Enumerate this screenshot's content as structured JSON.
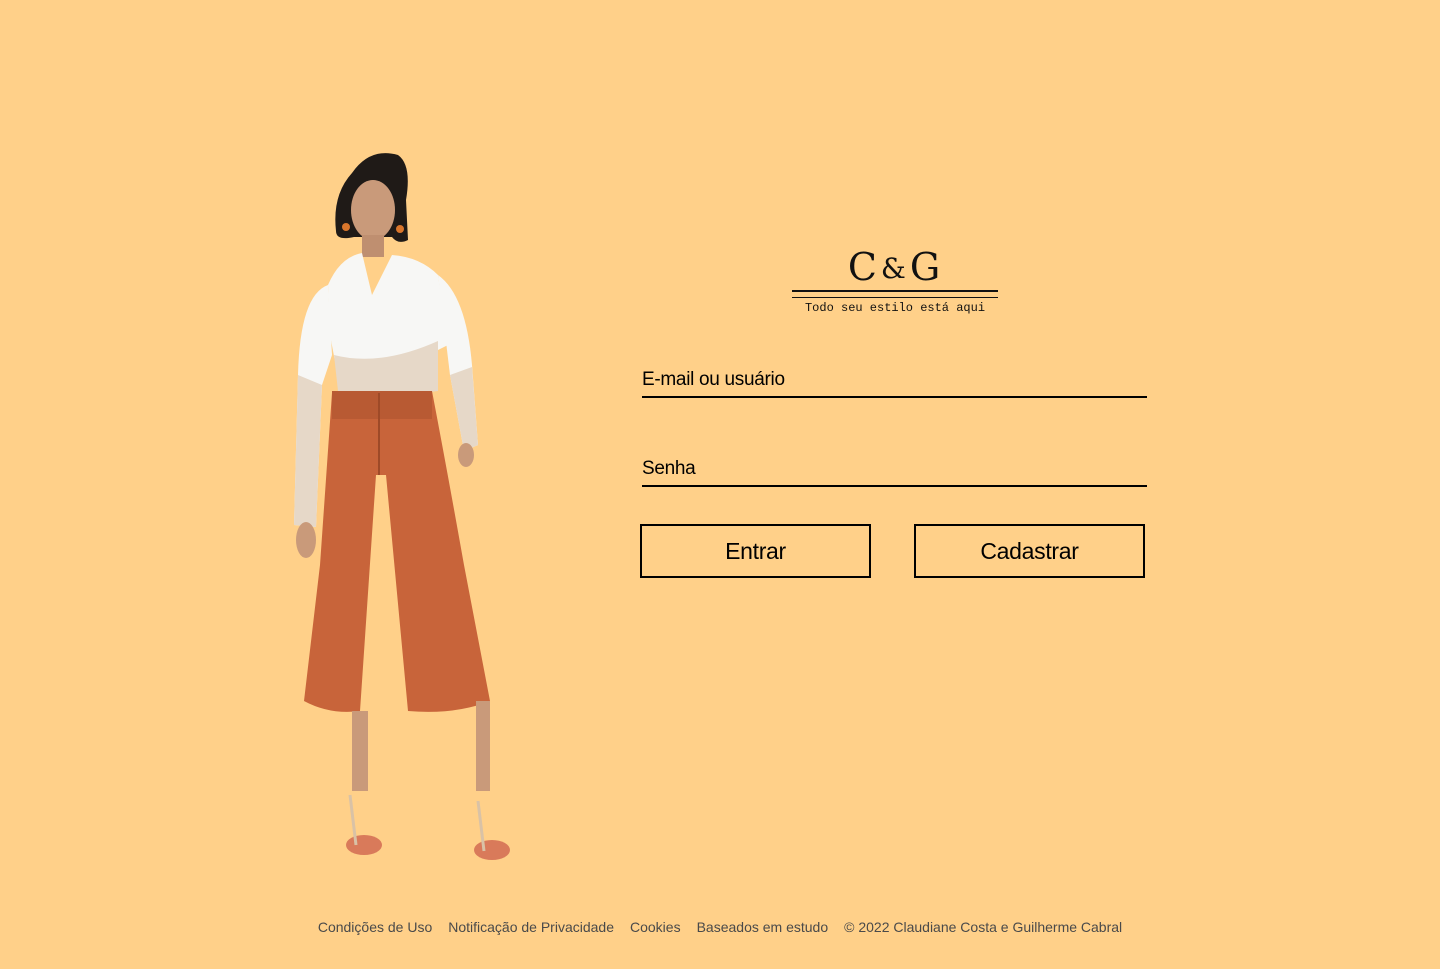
{
  "logo": {
    "left": "C",
    "amp": "&",
    "right": "G",
    "tagline": "Todo seu estilo está aqui"
  },
  "form": {
    "email_placeholder": "E-mail ou usuário",
    "password_placeholder": "Senha",
    "login_label": "Entrar",
    "register_label": "Cadastrar"
  },
  "footer": {
    "links": [
      "Condições de Uso",
      "Notificação de Privacidade",
      "Cookies",
      "Baseados em estudo"
    ],
    "copyright": "© 2022 Claudiane Costa e Guilherme Cabral"
  },
  "colors": {
    "background": "#ffd089",
    "pants": "#c8643a",
    "top_white": "#f7f7f5",
    "top_beige": "#e6d8c8"
  }
}
